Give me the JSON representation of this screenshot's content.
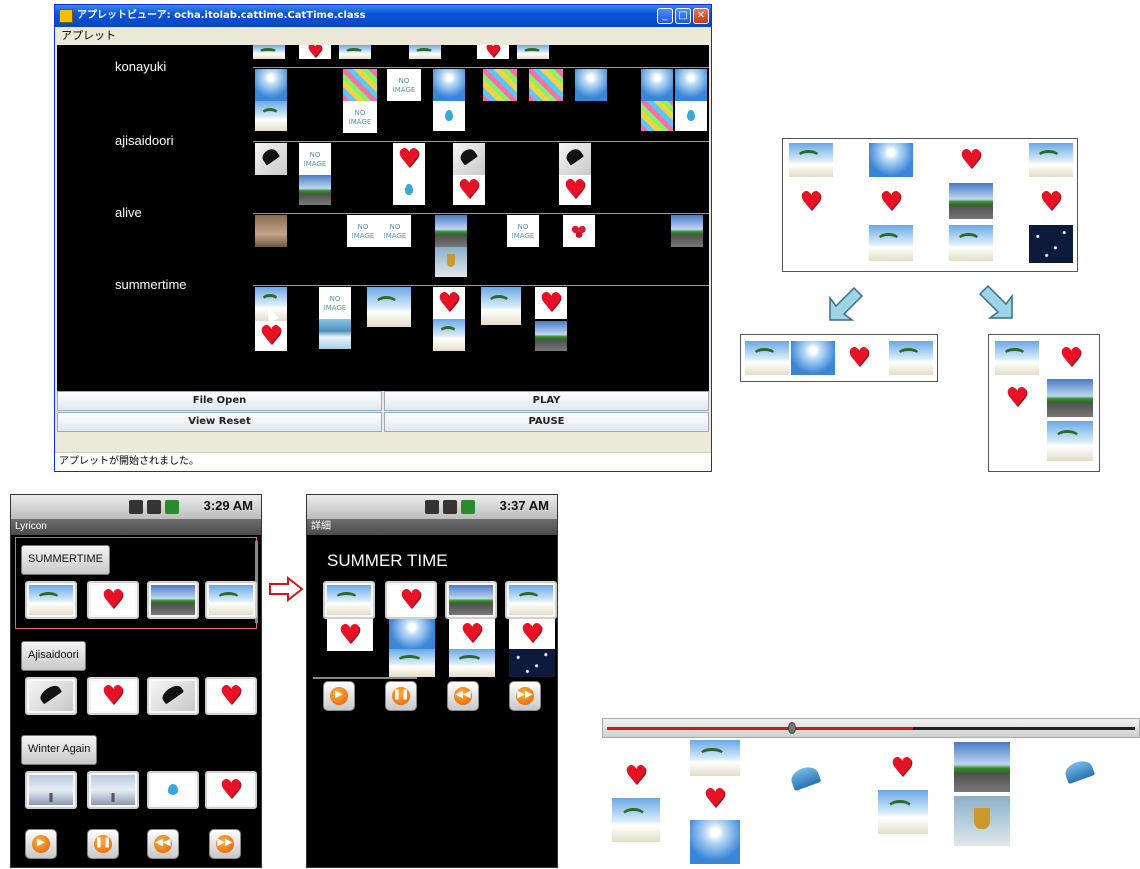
{
  "applet": {
    "title": "アプレットビューア: ocha.itolab.cattime.CatTime.class",
    "menu": "アプレット",
    "songs": [
      "konayuki",
      "ajisaidoori",
      "alive",
      "summertime"
    ],
    "buttons": {
      "file_open": "File Open",
      "play": "PLAY",
      "view_reset": "View Reset",
      "pause": "PAUSE"
    },
    "status": "アプレットが開始されました。"
  },
  "phone_list": {
    "clock": "3:29 AM",
    "app_title": "Lyricon",
    "songs": [
      "SUMMERTIME",
      "Ajisaidoori",
      "Winter Again"
    ]
  },
  "phone_detail": {
    "clock": "3:37 AM",
    "app_title": "詳細",
    "song_title": "SUMMER TIME"
  },
  "player": {
    "progress": 0.58
  },
  "icons": {
    "window_minimize": "minimize-icon",
    "window_maximize": "maximize-icon",
    "window_close": "close-icon",
    "play": "play-icon",
    "pause": "pause-icon",
    "rewind": "rewind-icon",
    "forward": "fast-forward-icon"
  },
  "colors": {
    "xp_titlebar": "#0a54d8",
    "heart": "#e81226",
    "seek_played": "#d01818",
    "control_orange": "#e45a00",
    "highlight_frame": "#e0608a",
    "diagram_arrow": "#9fd4e8"
  }
}
